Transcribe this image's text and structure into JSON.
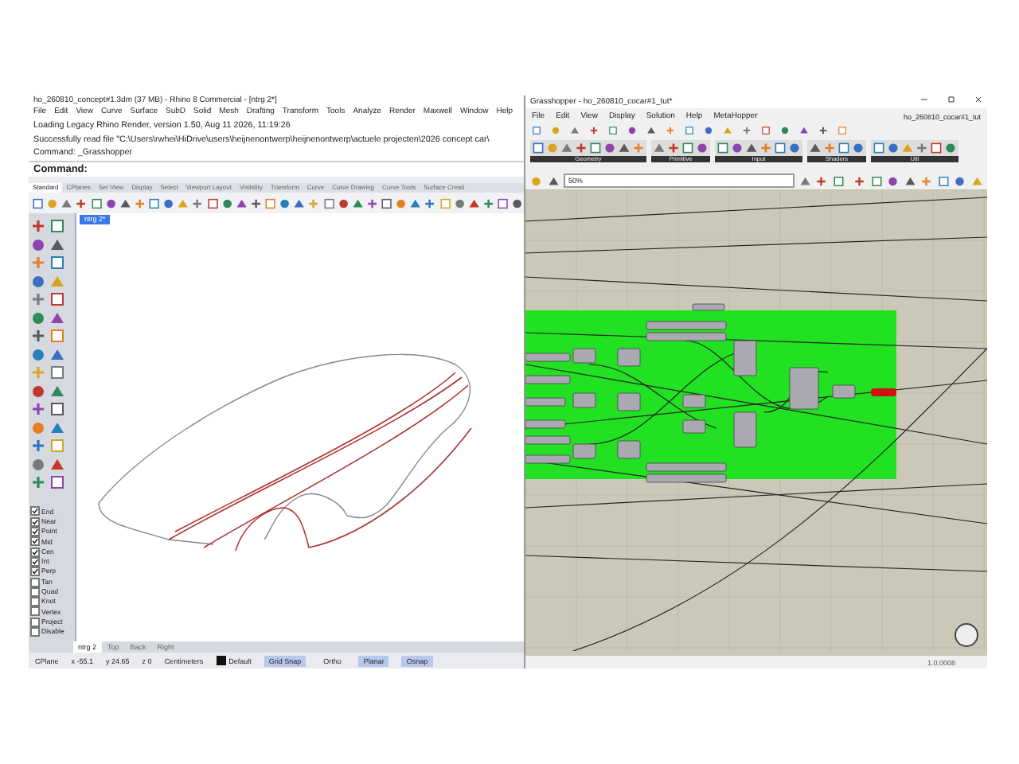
{
  "rhino": {
    "title": "ho_260810_concept#1.3dm (37 MB) - Rhino 8 Commercial - [ntrg 2*]",
    "menu": [
      "File",
      "Edit",
      "View",
      "Curve",
      "Surface",
      "SubD",
      "Solid",
      "Mesh",
      "Drafting",
      "Transform",
      "Tools",
      "Analyze",
      "Render",
      "Maxwell",
      "Window",
      "Help"
    ],
    "command_history": [
      "Loading Legacy Rhino Render, version 1.50, Aug 11 2026, 11:19:26",
      "Successfully read file \"C:\\Users\\rwhei\\HiDrive\\users\\heijnenontwerp\\heijnenontwerp\\actuele projecten\\2026 concept car\\",
      "Command: _Grasshopper"
    ],
    "command_prompt": "Command:",
    "toolbar_tabs": [
      {
        "label": "Standard",
        "selected": true
      },
      {
        "label": "CPlanes",
        "selected": false
      },
      {
        "label": "Set View",
        "selected": false
      },
      {
        "label": "Display",
        "selected": false
      },
      {
        "label": "Select",
        "selected": false
      },
      {
        "label": "Viewport Layout",
        "selected": false
      },
      {
        "label": "Visibility",
        "selected": false
      },
      {
        "label": "Transform",
        "selected": false
      },
      {
        "label": "Curve",
        "selected": false
      },
      {
        "label": "Curve Drawing",
        "selected": false
      },
      {
        "label": "Curve Tools",
        "selected": false
      },
      {
        "label": "Surface Creati",
        "selected": false
      }
    ],
    "viewport_title": "ntrg 2*",
    "osnaps": [
      {
        "label": "End",
        "checked": true
      },
      {
        "label": "Near",
        "checked": true
      },
      {
        "label": "Point",
        "checked": true
      },
      {
        "label": "Mid",
        "checked": true
      },
      {
        "label": "Cen",
        "checked": true
      },
      {
        "label": "Int",
        "checked": true
      },
      {
        "label": "Perp",
        "checked": true
      },
      {
        "label": "Tan",
        "checked": false
      },
      {
        "label": "Quad",
        "checked": false
      },
      {
        "label": "Knot",
        "checked": false
      },
      {
        "label": "Vertex",
        "checked": false
      },
      {
        "label": "Project",
        "checked": false
      },
      {
        "label": "Disable",
        "checked": false
      }
    ],
    "viewport_tabs": [
      {
        "label": "ntrg 2",
        "selected": true
      },
      {
        "label": "Top",
        "selected": false
      },
      {
        "label": "Back",
        "selected": false
      },
      {
        "label": "Right",
        "selected": false
      }
    ],
    "status": {
      "cplane": "CPlane",
      "x": "x -55.1",
      "y": "y 24.65",
      "z": "z 0",
      "units": "Centimeters",
      "layer": "Default",
      "toggles": [
        {
          "label": "Grid Snap",
          "on": true
        },
        {
          "label": "Ortho",
          "on": false
        },
        {
          "label": "Planar",
          "on": true
        },
        {
          "label": "Osnap",
          "on": true
        }
      ]
    }
  },
  "grasshopper": {
    "title": "Grasshopper - ho_260810_cocar#1_tut*",
    "menu": [
      "File",
      "Edit",
      "View",
      "Display",
      "Solution",
      "Help",
      "MetaHopper"
    ],
    "document_name": "ho_260810_cocar#1_tut",
    "component_groups": [
      "Geometry",
      "Primitive",
      "Input",
      "Shaders",
      "Util"
    ],
    "zoom": "50%",
    "version": "1.0.0008"
  }
}
